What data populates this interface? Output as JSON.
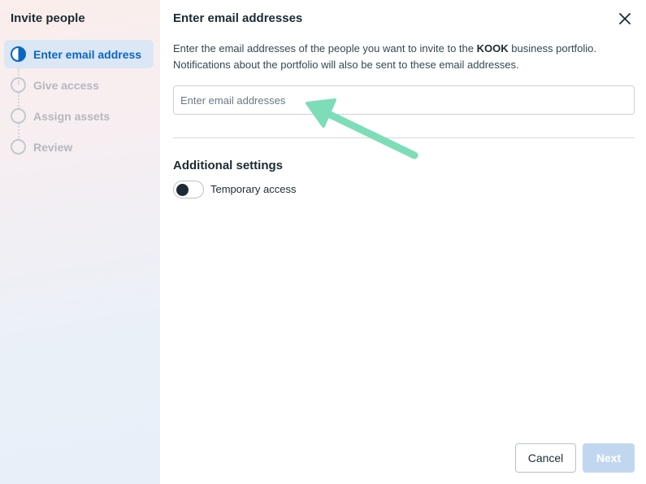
{
  "sidebar": {
    "title": "Invite people",
    "steps": [
      {
        "label": "Enter email address",
        "state": "active"
      },
      {
        "label": "Give access",
        "state": "pending"
      },
      {
        "label": "Assign assets",
        "state": "pending"
      },
      {
        "label": "Review",
        "state": "pending"
      }
    ]
  },
  "main": {
    "title": "Enter email addresses",
    "description_before": "Enter the email addresses of the people you want to invite to the ",
    "description_brand": "KOOK",
    "description_after": " business portfolio. Notifications about the portfolio will also be sent to these email addresses.",
    "email_input": {
      "value": "",
      "placeholder": "Enter email addresses"
    },
    "additional_settings_title": "Additional settings",
    "temporary_access": {
      "label": "Temporary access",
      "enabled": false
    }
  },
  "footer": {
    "cancel_label": "Cancel",
    "next_label": "Next"
  },
  "icons": {
    "close": "close-icon",
    "annotation_arrow": "arrow-icon"
  },
  "colors": {
    "accent": "#0a66c2",
    "next_disabled": "#c1d7f0",
    "annotation_arrow": "#7dddb8"
  }
}
